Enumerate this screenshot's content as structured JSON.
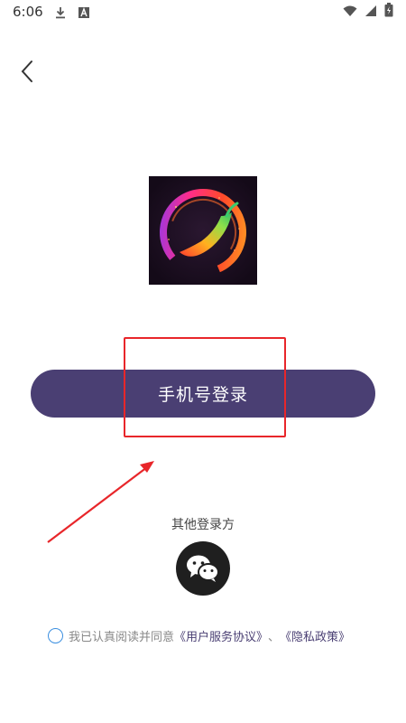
{
  "status_bar": {
    "time": "6:06",
    "icons_left": [
      "download-icon",
      "a-box-icon"
    ],
    "icons_right": [
      "wifi-icon",
      "signal-icon",
      "battery-charging-icon"
    ]
  },
  "nav": {
    "back_icon": "chevron-left-icon"
  },
  "logo": {
    "icon": "app-logo-chili-ring"
  },
  "login": {
    "phone_label": "手机号登录"
  },
  "other": {
    "label": "其他登录方",
    "wechat_icon": "wechat-icon"
  },
  "agreement": {
    "prefix": "我已认真阅读并同意",
    "terms_link": "《用户服务协议》",
    "separator": "、",
    "privacy_link": "《隐私政策》"
  },
  "colors": {
    "primary": "#4a3f73",
    "annotation": "#e8262a",
    "checkbox": "#3b8fe0"
  }
}
